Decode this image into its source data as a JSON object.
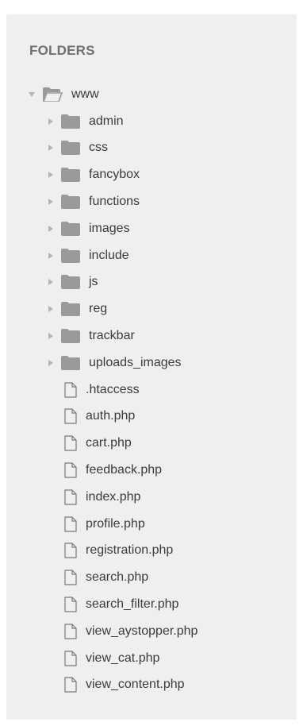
{
  "sidebar": {
    "section_title": "FOLDERS",
    "root": {
      "label": "www",
      "expanded": true,
      "icon": "folder-open-icon"
    },
    "folders": [
      {
        "label": "admin"
      },
      {
        "label": "css"
      },
      {
        "label": "fancybox"
      },
      {
        "label": "functions"
      },
      {
        "label": "images"
      },
      {
        "label": "include"
      },
      {
        "label": "js"
      },
      {
        "label": "reg"
      },
      {
        "label": "trackbar"
      },
      {
        "label": "uploads_images"
      }
    ],
    "files": [
      {
        "label": ".htaccess"
      },
      {
        "label": "auth.php"
      },
      {
        "label": "cart.php"
      },
      {
        "label": "feedback.php"
      },
      {
        "label": "index.php"
      },
      {
        "label": "profile.php"
      },
      {
        "label": "registration.php"
      },
      {
        "label": "search.php"
      },
      {
        "label": "search_filter.php"
      },
      {
        "label": "view_aystopper.php"
      },
      {
        "label": "view_cat.php"
      },
      {
        "label": "view_content.php"
      }
    ]
  },
  "colors": {
    "panel_bg": "#efefef",
    "text": "#3b3b3b",
    "title": "#6f6f6f",
    "icon": "#9a9a9a",
    "arrow": "#b4b4b4"
  }
}
